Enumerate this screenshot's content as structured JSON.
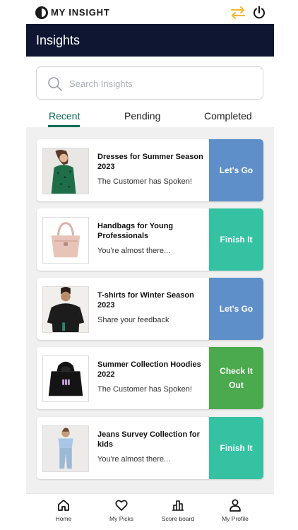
{
  "brand": {
    "name": "MY INSIGHT"
  },
  "header": {
    "title": "Insights"
  },
  "search": {
    "placeholder": "Search Insights"
  },
  "tabs": [
    {
      "label": "Recent",
      "active": true
    },
    {
      "label": "Pending",
      "active": false
    },
    {
      "label": "Completed",
      "active": false
    }
  ],
  "colors": {
    "header_bg": "#0e1632",
    "accent_green": "#0d6b57",
    "action_blue": "#5e8fc9",
    "action_teal": "#35c2a3",
    "action_green": "#4caa4e",
    "swap_icon": "#f2b630"
  },
  "insights": [
    {
      "title": "Dresses for Summer Season 2023",
      "subtitle": "The Customer has Spoken!",
      "action": "Let's Go",
      "image": "green-dress-photo"
    },
    {
      "title": "Handbags for Young Professionals",
      "subtitle": "You're almost there...",
      "action": "Finish It",
      "image": "pink-handbag-photo"
    },
    {
      "title": "T-shirts for Winter Season 2023",
      "subtitle": "Share your feedback",
      "action": "Let's Go",
      "image": "black-tshirt-photo"
    },
    {
      "title": "Summer Collection Hoodies 2022",
      "subtitle": "The Customer has Spoken!",
      "action": "Check It Out",
      "image": "black-hoodie-photo"
    },
    {
      "title": "Jeans Survey Collection for kids",
      "subtitle": "You're almost there...",
      "action": "Finish It",
      "image": "kids-jeans-photo"
    }
  ],
  "nav": [
    {
      "label": "Home",
      "icon": "home-icon",
      "active": true
    },
    {
      "label": "My Picks",
      "icon": "heart-icon",
      "active": false
    },
    {
      "label": "Score board",
      "icon": "bar-chart-icon",
      "active": false
    },
    {
      "label": "My Profile",
      "icon": "person-icon",
      "active": false
    }
  ]
}
